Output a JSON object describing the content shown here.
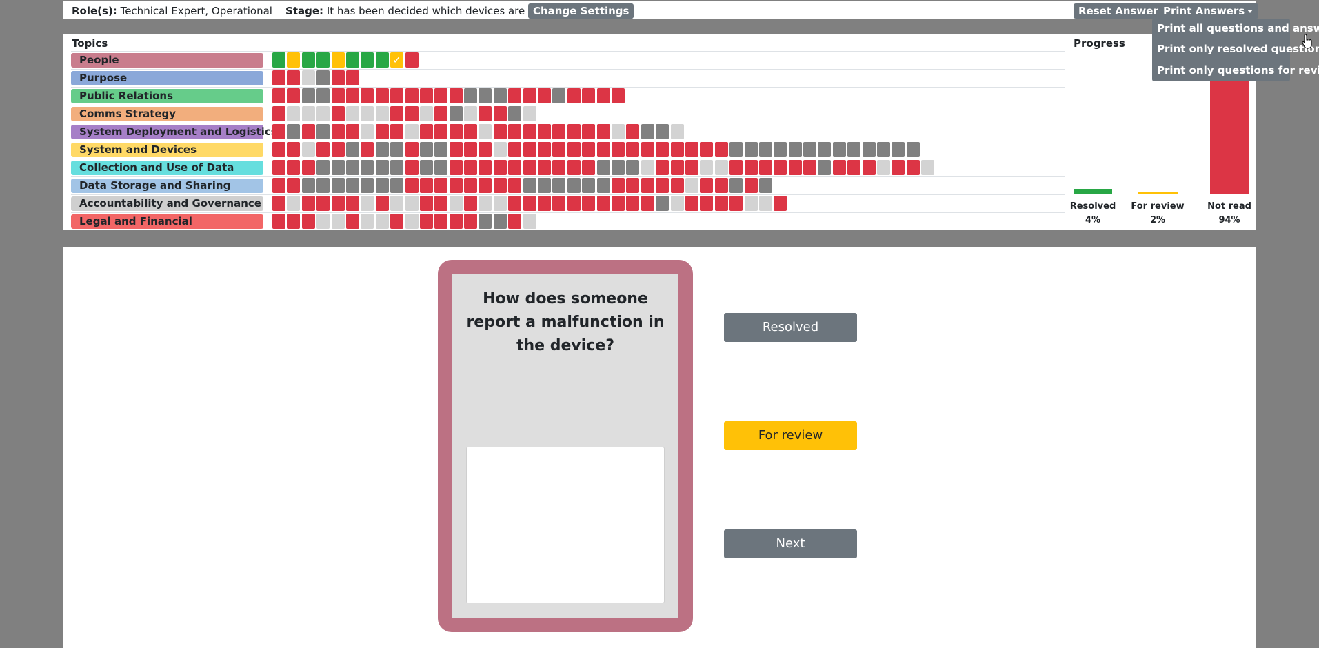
{
  "header": {
    "roles_label": "Role(s):",
    "roles_value": "Technical Expert, Operational",
    "stage_label": "Stage:",
    "stage_value": "It has been decided which devices are to be used",
    "change_settings": "Change Settings",
    "reset_answers": "Reset Answers",
    "print_answers": "Print Answers",
    "print_menu": [
      "Print all questions and answers",
      "Print only resolved questions",
      "Print only questions for review"
    ]
  },
  "status_colors": {
    "G": "#28a745",
    "Y": "#ffc107",
    "R": "#dc3545",
    "D": "#808080",
    "L": "#d3d3d3"
  },
  "topics_heading": "Topics",
  "topics": [
    {
      "label": "People",
      "color": "#c97d8d",
      "statuses": "GYGGYGGGTR"
    },
    {
      "label": "Purpose",
      "color": "#8aa8d9",
      "statuses": "RRLDRR"
    },
    {
      "label": "Public Relations",
      "color": "#66cc8a",
      "statuses": "RRDDRRRRRRRRRDDDRRRDRRRR"
    },
    {
      "label": "Comms Strategy",
      "color": "#f2ae7d",
      "statuses": "RLLLRLLLRRLRDLRRDL"
    },
    {
      "label": "System Deployment and Logistics",
      "color": "#a67fc7",
      "statuses": "RDRDRRLRRLRRRRLRRRRRRRRLRDDL"
    },
    {
      "label": "System and Devices",
      "color": "#ffd966",
      "statuses": "RRLRRDRDDRDDRRRLRRRRRRRRRRRRRRRDDDDDDDDDDDDD"
    },
    {
      "label": "Collection and Use of Data",
      "color": "#66dede",
      "statuses": "RRRDDDDDDRDDRRRRRRRRRRDDDLRRRLLRRRRRRDRRRLRRL"
    },
    {
      "label": "Data Storage and Sharing",
      "color": "#a2c4e6",
      "statuses": "RRDDDDDDDRRRRRRRRDDDDDDRRRRRLRRDRD"
    },
    {
      "label": "Accountability and Governance",
      "color": "#cfcfcf",
      "statuses": "RLRRRRLRLLRRLRLLRRRRRRRRRRDLRRRRLLR"
    },
    {
      "label": "Legal and Financial",
      "color": "#f26666",
      "statuses": "RRRLLRLLRLRRRRDDRL"
    }
  ],
  "progress": {
    "heading": "Progress",
    "items": [
      {
        "label": "Resolved",
        "percent_text": "4%",
        "value": 4,
        "color": "#28a745"
      },
      {
        "label": "For review",
        "percent_text": "2%",
        "value": 2,
        "color": "#ffc107"
      },
      {
        "label": "Not read",
        "percent_text": "94%",
        "value": 94,
        "color": "#dc3545"
      }
    ]
  },
  "question": {
    "text": "How does someone report a malfunction in the device?",
    "answer_value": ""
  },
  "actions": {
    "resolved": "Resolved",
    "for_review": "For review",
    "next": "Next"
  }
}
